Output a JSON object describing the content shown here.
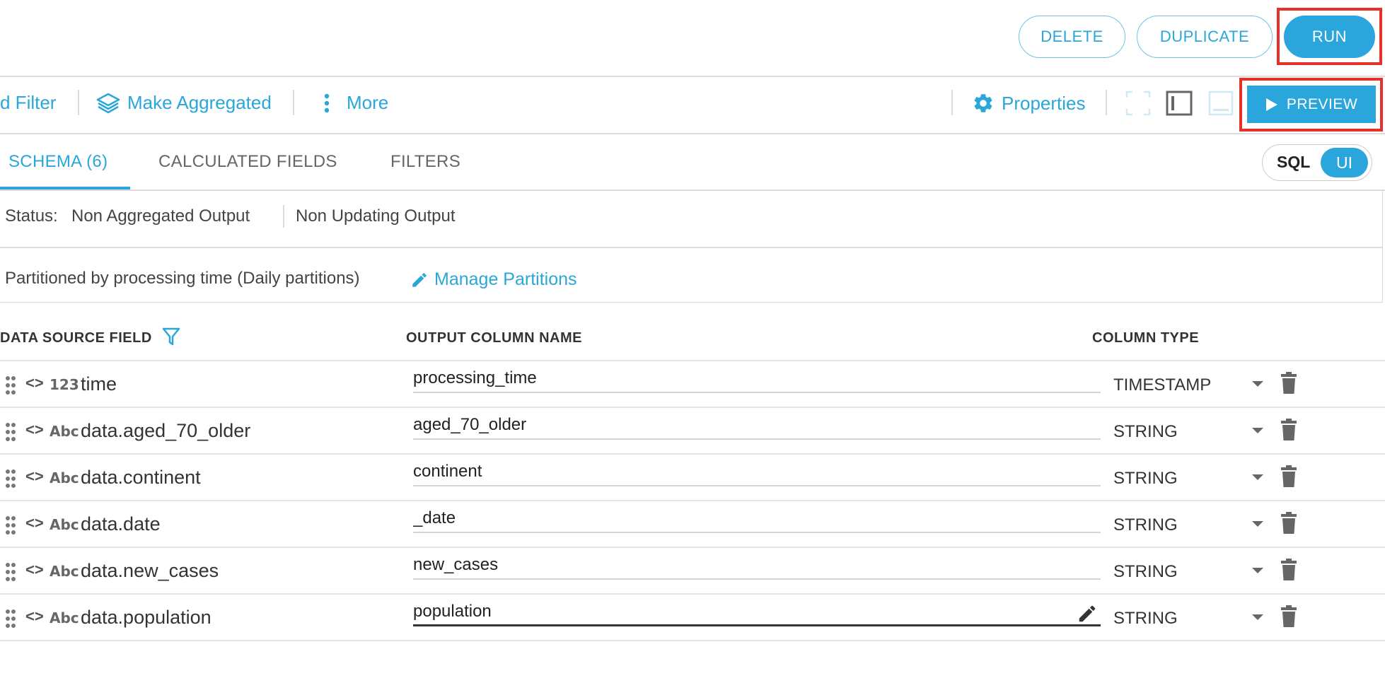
{
  "header": {
    "delete_label": "DELETE",
    "duplicate_label": "DUPLICATE",
    "run_label": "RUN"
  },
  "toolbar": {
    "add_filter_label": "d Filter",
    "make_aggregated_label": "Make Aggregated",
    "more_label": "More",
    "properties_label": "Properties",
    "preview_label": "PREVIEW"
  },
  "tabs": [
    {
      "label": "SCHEMA (6)",
      "active": true
    },
    {
      "label": "CALCULATED FIELDS",
      "active": false
    },
    {
      "label": "FILTERS",
      "active": false
    }
  ],
  "mode_toggle": {
    "sql_label": "SQL",
    "ui_label": "UI",
    "selected": "UI"
  },
  "status": {
    "label": "Status:",
    "aggregated": "Non Aggregated Output",
    "updating": "Non Updating Output"
  },
  "partition": {
    "text": "Partitioned by processing time (Daily partitions)",
    "manage_label": "Manage Partitions"
  },
  "table": {
    "headers": {
      "source": "DATA SOURCE FIELD",
      "output": "OUTPUT COLUMN NAME",
      "type": "COLUMN TYPE"
    },
    "rows": [
      {
        "type_badge": "123",
        "source": "time",
        "output": "processing_time",
        "column_type": "TIMESTAMP"
      },
      {
        "type_badge": "Abc",
        "source": "data.aged_70_older",
        "output": "aged_70_older",
        "column_type": "STRING"
      },
      {
        "type_badge": "Abc",
        "source": "data.continent",
        "output": "continent",
        "column_type": "STRING"
      },
      {
        "type_badge": "Abc",
        "source": "data.date",
        "output": "_date",
        "column_type": "STRING"
      },
      {
        "type_badge": "Abc",
        "source": "data.new_cases",
        "output": "new_cases",
        "column_type": "STRING"
      },
      {
        "type_badge": "Abc",
        "source": "data.population",
        "output": "population",
        "column_type": "STRING"
      }
    ]
  },
  "colors": {
    "accent": "#2aa6dd",
    "highlight": "#e8302b"
  }
}
